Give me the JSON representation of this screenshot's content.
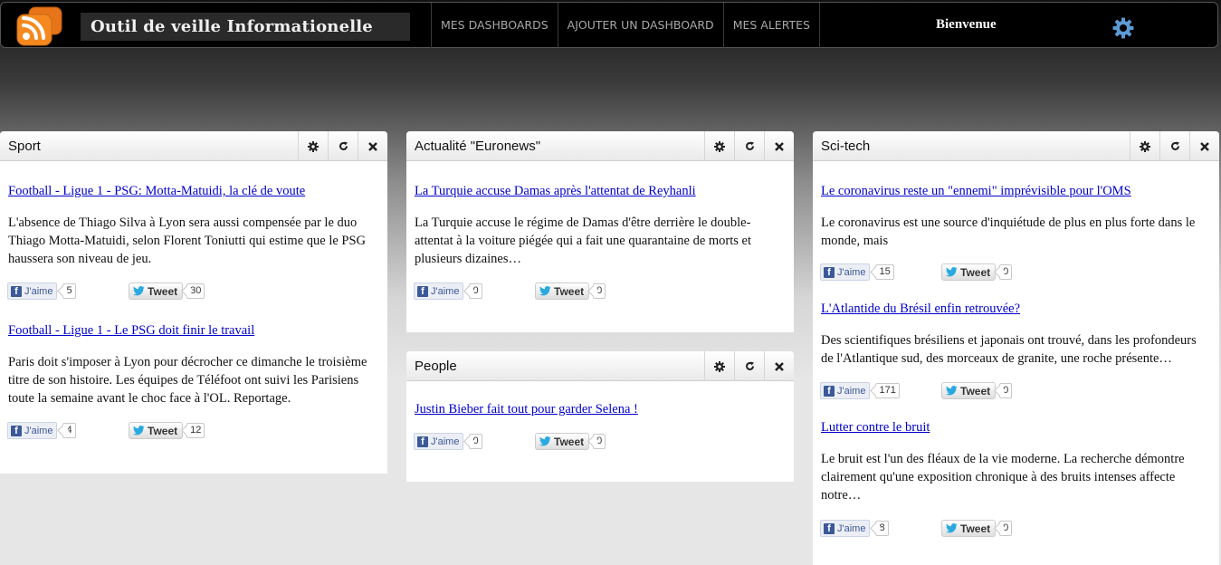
{
  "header": {
    "app_title": "Outil de veille Informationelle",
    "nav": [
      "MES DASHBOARDS",
      "AJOUTER UN DASHBOARD",
      "MES ALERTES"
    ],
    "welcome": "Bienvenue"
  },
  "colors": {
    "accent_link": "#0000cc",
    "rss_orange": "#f5891f",
    "settings_blue": "#5b9bd5",
    "facebook_blue": "#3b5998",
    "twitter_blue": "#2aa9e0"
  },
  "social": {
    "like_label": "J'aime",
    "tweet_label": "Tweet"
  },
  "widgets": [
    {
      "title": "Sport",
      "articles": [
        {
          "title": "Football - Ligue 1 - PSG: Motta-Matuidi, la clé de voute",
          "text": "L'absence de Thiago Silva à Lyon sera aussi compensée par le duo Thiago Motta-Matuidi, selon Florent Toniutti qui estime que le PSG haussera son niveau de jeu.",
          "likes": "5",
          "tweets": "30"
        },
        {
          "title": "Football - Ligue 1 - Le PSG doit finir le travail",
          "text": "Paris doit s'imposer à Lyon pour décrocher ce dimanche le troisième titre de son histoire. Les équipes de Téléfoot ont suivi les Parisiens toute la semaine avant le choc face à l'OL. Reportage.",
          "likes": "4",
          "tweets": "12"
        }
      ]
    },
    {
      "title": "Actualité \"Euronews\"",
      "articles": [
        {
          "title": "La Turquie accuse Damas après l'attentat de Reyhanli",
          "text": "La Turquie accuse le régime de Damas d'être derrière le double-attentat à la voiture piégée qui a fait une quarantaine de morts et plusieurs dizaines…",
          "likes": "0",
          "tweets": "0"
        }
      ]
    },
    {
      "title": "People",
      "articles": [
        {
          "title": "Justin Bieber fait tout pour garder Selena !",
          "text": "",
          "likes": "0",
          "tweets": "0"
        }
      ]
    },
    {
      "title": "Sci-tech",
      "articles": [
        {
          "title": "Le coronavirus reste un \"ennemi\" imprévisible pour l'OMS",
          "text": "Le coronavirus est une source d'inquiétude de plus en plus forte dans le monde, mais",
          "likes": "15",
          "tweets": "0"
        },
        {
          "title": "L'Atlantide du Brésil enfin retrouvée?",
          "text": "Des scientifiques brésiliens et japonais ont trouvé, dans les profondeurs de l'Atlantique sud, des morceaux de granite, une roche présente…",
          "likes": "171",
          "tweets": "0"
        },
        {
          "title": "Lutter contre le bruit",
          "text": "Le bruit est l'un des fléaux de la vie moderne. La recherche démontre clairement qu'une exposition chronique à des bruits intenses affecte notre…",
          "likes": "8",
          "tweets": "0"
        }
      ]
    }
  ]
}
